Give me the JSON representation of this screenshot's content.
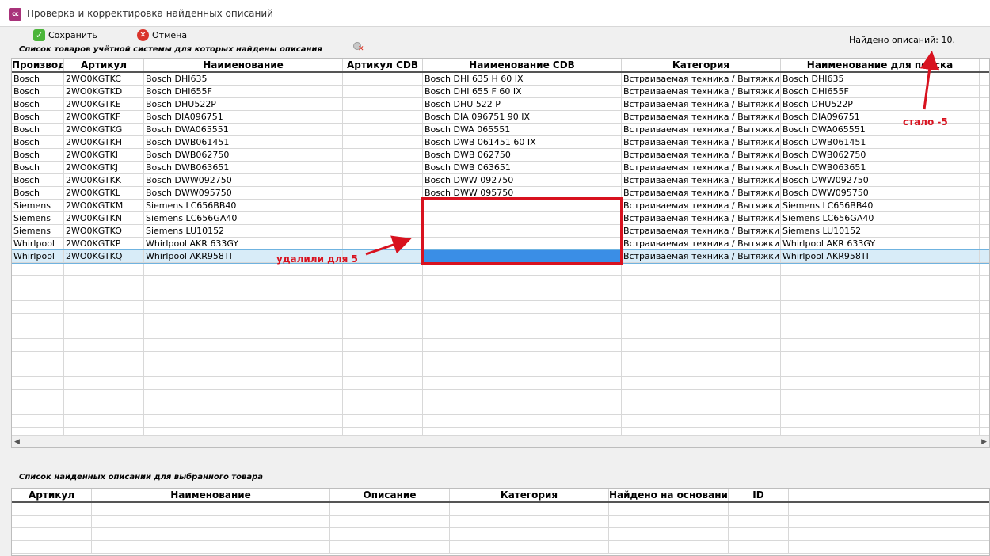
{
  "window": {
    "title": "Проверка и корректировка найденных описаний",
    "app_icon_label": "cc"
  },
  "toolbar": {
    "save_label": "Сохранить",
    "cancel_label": "Отмена"
  },
  "found": {
    "label": "Найдено описаний: 10."
  },
  "grid1": {
    "caption": "Список товаров учётной системы для которых найдены описания",
    "columns": [
      "Производитель",
      "Артикул",
      "Наименование",
      "Артикул CDB",
      "Наименование CDB",
      "Категория",
      "Наименование для поиска"
    ],
    "rows": [
      [
        "Bosch",
        "2WO0KGTKC",
        "Bosch DHI635",
        "",
        "Bosch DHI 635 H 60 IX",
        "Встраиваемая техника / Вытяжки кух",
        "Bosch DHI635"
      ],
      [
        "Bosch",
        "2WO0KGTKD",
        "Bosch DHI655F",
        "",
        "Bosch DHI 655 F 60 IX",
        "Встраиваемая техника / Вытяжки кух",
        "Bosch DHI655F"
      ],
      [
        "Bosch",
        "2WO0KGTKE",
        "Bosch DHU522P",
        "",
        "Bosch DHU 522 P",
        "Встраиваемая техника / Вытяжки кух",
        "Bosch DHU522P"
      ],
      [
        "Bosch",
        "2WO0KGTKF",
        "Bosch DIA096751",
        "",
        "Bosch DIA 096751 90 IX",
        "Встраиваемая техника / Вытяжки кух",
        "Bosch DIA096751"
      ],
      [
        "Bosch",
        "2WO0KGTKG",
        "Bosch DWA065551",
        "",
        "Bosch DWA 065551",
        "Встраиваемая техника / Вытяжки кух",
        "Bosch DWA065551"
      ],
      [
        "Bosch",
        "2WO0KGTKH",
        "Bosch DWB061451",
        "",
        "Bosch DWB 061451 60 IX",
        "Встраиваемая техника / Вытяжки кух",
        "Bosch DWB061451"
      ],
      [
        "Bosch",
        "2WO0KGTKI",
        "Bosch DWB062750",
        "",
        "Bosch DWB 062750",
        "Встраиваемая техника / Вытяжки кух",
        "Bosch DWB062750"
      ],
      [
        "Bosch",
        "2WO0KGTKJ",
        "Bosch DWB063651",
        "",
        "Bosch DWB 063651",
        "Встраиваемая техника / Вытяжки кух",
        "Bosch DWB063651"
      ],
      [
        "Bosch",
        "2WO0KGTKK",
        "Bosch DWW092750",
        "",
        "Bosch DWW 092750",
        "Встраиваемая техника / Вытяжки кух",
        "Bosch DWW092750"
      ],
      [
        "Bosch",
        "2WO0KGTKL",
        "Bosch DWW095750",
        "",
        "Bosch DWW 095750",
        "Встраиваемая техника / Вытяжки кух",
        "Bosch DWW095750"
      ],
      [
        "Siemens",
        "2WO0KGTKM",
        "Siemens LC656BB40",
        "",
        "",
        "Встраиваемая техника / Вытяжки кух",
        "Siemens LC656BB40"
      ],
      [
        "Siemens",
        "2WO0KGTKN",
        "Siemens LC656GA40",
        "",
        "",
        "Встраиваемая техника / Вытяжки кух",
        "Siemens LC656GA40"
      ],
      [
        "Siemens",
        "2WO0KGTKO",
        "Siemens LU10152",
        "",
        "",
        "Встраиваемая техника / Вытяжки кух",
        "Siemens LU10152"
      ],
      [
        "Whirlpool",
        "2WO0KGTKP",
        "Whirlpool AKR 633GY",
        "",
        "",
        "Встраиваемая техника / Вытяжки кух",
        "Whirlpool AKR 633GY"
      ],
      [
        "Whirlpool",
        "2WO0KGTKQ",
        "Whirlpool AKR958TI",
        "",
        "",
        "Встраиваемая техника / Вытяжки кух",
        "Whirlpool AKR958TI"
      ]
    ],
    "selected_row": 14
  },
  "grid2": {
    "caption": "Список найденных описаний для выбранного товара",
    "columns": [
      "Артикул",
      "Наименование",
      "Описание",
      "Категория",
      "Найдено на основании",
      "ID"
    ]
  },
  "annotations": {
    "deleted": "удалили для 5",
    "became": "стало -5",
    "color": "#d8121f"
  }
}
